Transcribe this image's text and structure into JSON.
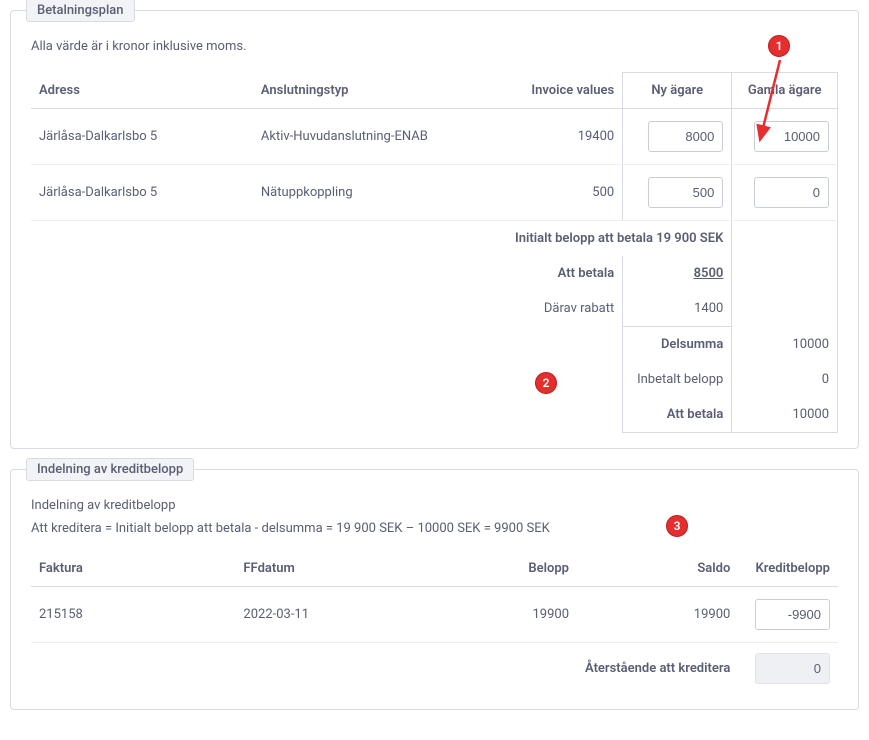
{
  "section1": {
    "title": "Betalningsplan",
    "subtext": "Alla värde är i kronor inklusive moms.",
    "headers": {
      "adress": "Adress",
      "anslutningstyp": "Anslutningstyp",
      "invoice_values": "Invoice values",
      "ny_agare": "Ny ägare",
      "gamla_agare": "Gamla ägare"
    },
    "rows": [
      {
        "adress": "Järlåsa-Dalkarlsbo 5",
        "typ": "Aktiv-Huvudanslutning-ENAB",
        "invoice": "19400",
        "ny": "8000",
        "gamla": "10000"
      },
      {
        "adress": "Järlåsa-Dalkarlsbo 5",
        "typ": "Nätuppkoppling",
        "invoice": "500",
        "ny": "500",
        "gamla": "0"
      }
    ],
    "initial_label": "Initialt belopp att betala 19 900 SEK",
    "att_betala_label": "Att betala",
    "att_betala_value": "8500",
    "darav_label": "Därav rabatt",
    "darav_value": "1400",
    "delsumma_label": "Delsumma",
    "delsumma_value": "10000",
    "inbetalt_label": "Inbetalt belopp",
    "inbetalt_value": "0",
    "att_betala2_label": "Att betala",
    "att_betala2_value": "10000"
  },
  "section2": {
    "title": "Indelning av kreditbelopp",
    "subtitle": "Indelning av kreditbelopp",
    "formula": "Att kreditera = Initialt belopp att betala - delsumma = 19 900 SEK – 10000 SEK = 9900 SEK",
    "headers": {
      "faktura": "Faktura",
      "ffdatum": "FFdatum",
      "belopp": "Belopp",
      "saldo": "Saldo",
      "kreditbelopp": "Kreditbelopp"
    },
    "rows": [
      {
        "faktura": "215158",
        "ffdatum": "2022-03-11",
        "belopp": "19900",
        "saldo": "19900",
        "kredit": "-9900"
      }
    ],
    "aterstaende_label": "Återstående att kreditera",
    "aterstaende_value": "0"
  },
  "badges": {
    "b1": "1",
    "b2": "2",
    "b3": "3"
  }
}
